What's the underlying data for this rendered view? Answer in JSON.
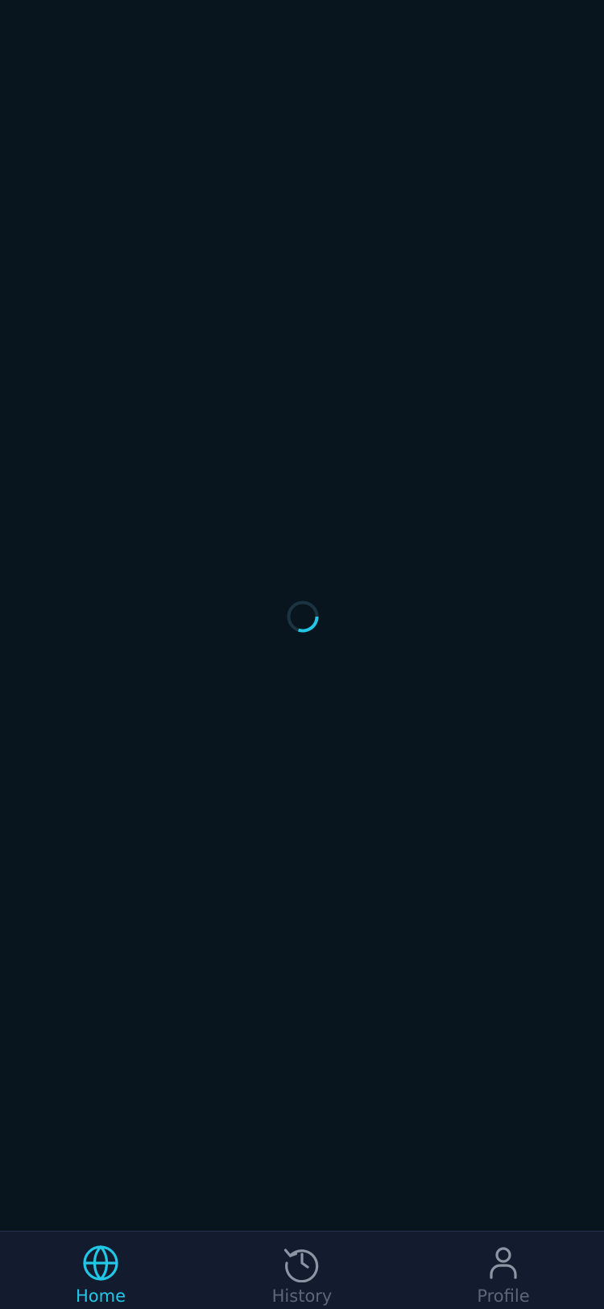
{
  "colors": {
    "background": "#08151e",
    "tabbar_background": "#131c2e",
    "accent": "#22c7e6",
    "inactive": "#8b95a3",
    "inactive_label": "#5d6676",
    "spinner_track": "#1b3442"
  },
  "loading": {
    "icon": "loading-spinner",
    "progress_fraction": 0.3
  },
  "tabbar": {
    "active": "home",
    "tabs": [
      {
        "id": "home",
        "label": "Home",
        "icon": "globe-icon"
      },
      {
        "id": "history",
        "label": "History",
        "icon": "history-icon"
      },
      {
        "id": "profile",
        "label": "Profile",
        "icon": "user-icon"
      }
    ]
  }
}
